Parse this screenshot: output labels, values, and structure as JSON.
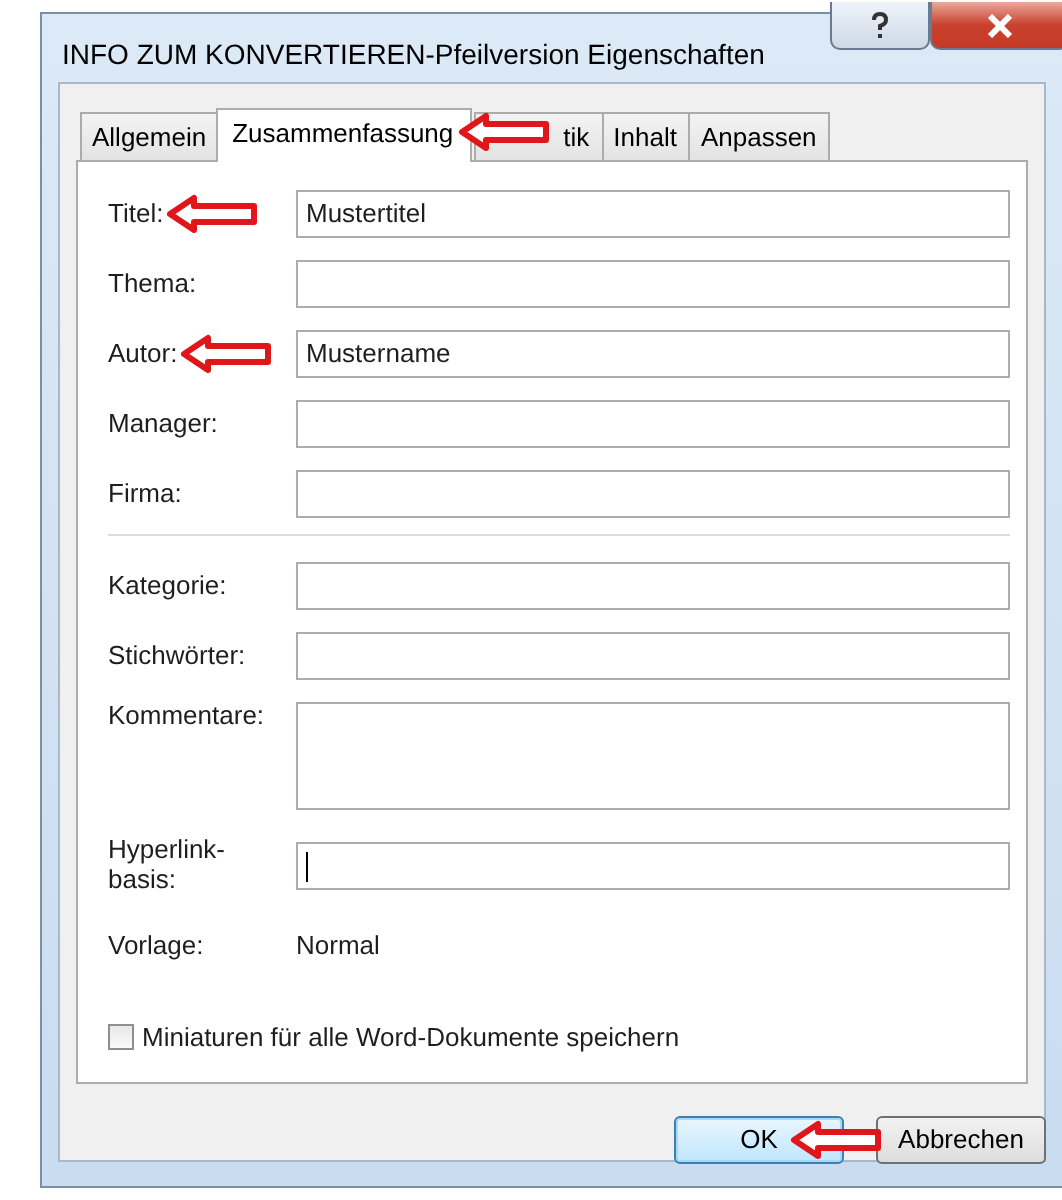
{
  "window": {
    "title": "INFO ZUM KONVERTIEREN-Pfeilversion Eigenschaften"
  },
  "tabs": [
    {
      "label": "Allgemein",
      "selected": false,
      "marked": false
    },
    {
      "label": "Zusammenfassung",
      "selected": true,
      "marked": true
    },
    {
      "label": "tik",
      "selected": false,
      "marked": false
    },
    {
      "label": "Inhalt",
      "selected": false,
      "marked": false
    },
    {
      "label": "Anpassen",
      "selected": false,
      "marked": false
    }
  ],
  "fields": [
    {
      "kind": "text",
      "label": "Titel:",
      "value": "Mustertitel",
      "marked": true,
      "focused": false
    },
    {
      "kind": "text",
      "label": "Thema:",
      "marked": false,
      "focused": false
    },
    {
      "kind": "text",
      "label": "Autor:",
      "value": "Mustername",
      "marked": true,
      "focused": false
    },
    {
      "kind": "text",
      "label": "Manager:",
      "marked": false,
      "focused": false
    },
    {
      "kind": "text",
      "label": "Firma:",
      "marked": false,
      "focused": false
    },
    {
      "kind": "separator"
    },
    {
      "kind": "text",
      "label": "Kategorie:",
      "marked": false,
      "focused": false
    },
    {
      "kind": "text",
      "label": "Stichwörter:",
      "marked": false,
      "focused": false
    },
    {
      "kind": "textarea",
      "label": "Kommentare:",
      "marked": false,
      "focused": false
    },
    {
      "kind": "text",
      "label": "Hyperlink-basis:",
      "marked": false,
      "focused": true
    },
    {
      "kind": "static",
      "label": "Vorlage:",
      "value": "Normal",
      "marked": false
    }
  ],
  "checkbox": {
    "label": "Miniaturen für alle Word-Dokumente speichern",
    "checked": false
  },
  "buttons": [
    {
      "label": "OK",
      "default": true,
      "marked": true
    },
    {
      "label": "Abbrechen",
      "default": false,
      "marked": false
    }
  ]
}
